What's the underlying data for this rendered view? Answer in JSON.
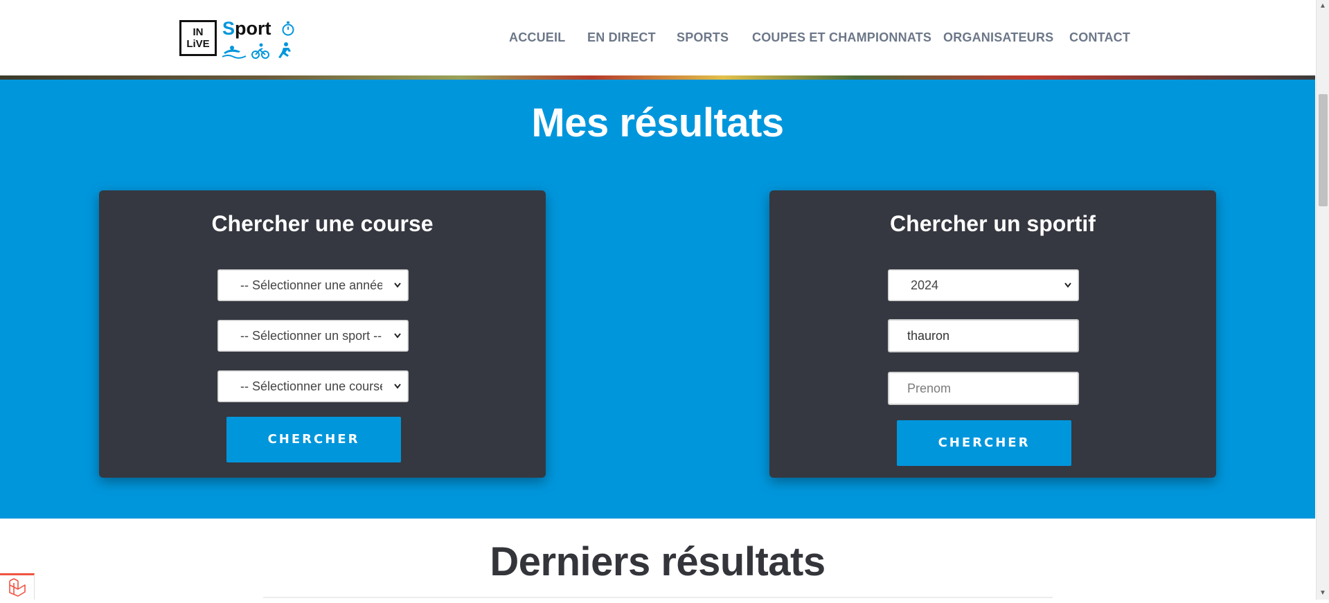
{
  "header": {
    "logo": {
      "line1": "IN",
      "line2": "LiVE",
      "brand_first": "S",
      "brand_rest": "port"
    },
    "nav": [
      {
        "label": "ACCUEIL"
      },
      {
        "label": "EN DIRECT"
      },
      {
        "label": "SPORTS"
      },
      {
        "label": "COUPES ET CHAMPIONNATS"
      },
      {
        "label": "ORGANISATEURS"
      },
      {
        "label": "CONTACT"
      }
    ]
  },
  "results": {
    "title": "Mes résultats",
    "course_search": {
      "title": "Chercher une course",
      "year_select": "-- Sélectionner une année --",
      "sport_select": "-- Sélectionner un sport --",
      "race_select": "-- Sélectionner une course --",
      "button": "CHERCHER"
    },
    "athlete_search": {
      "title": "Chercher un sportif",
      "year_select": "2024",
      "name_value": "thauron",
      "firstname_placeholder": "Prenom",
      "button": "CHERCHER"
    }
  },
  "latest": {
    "title": "Derniers résultats"
  },
  "colors": {
    "primary": "#0096dc",
    "card": "#353840",
    "nav_text": "#6c7788",
    "heading_dark": "#33353a"
  }
}
